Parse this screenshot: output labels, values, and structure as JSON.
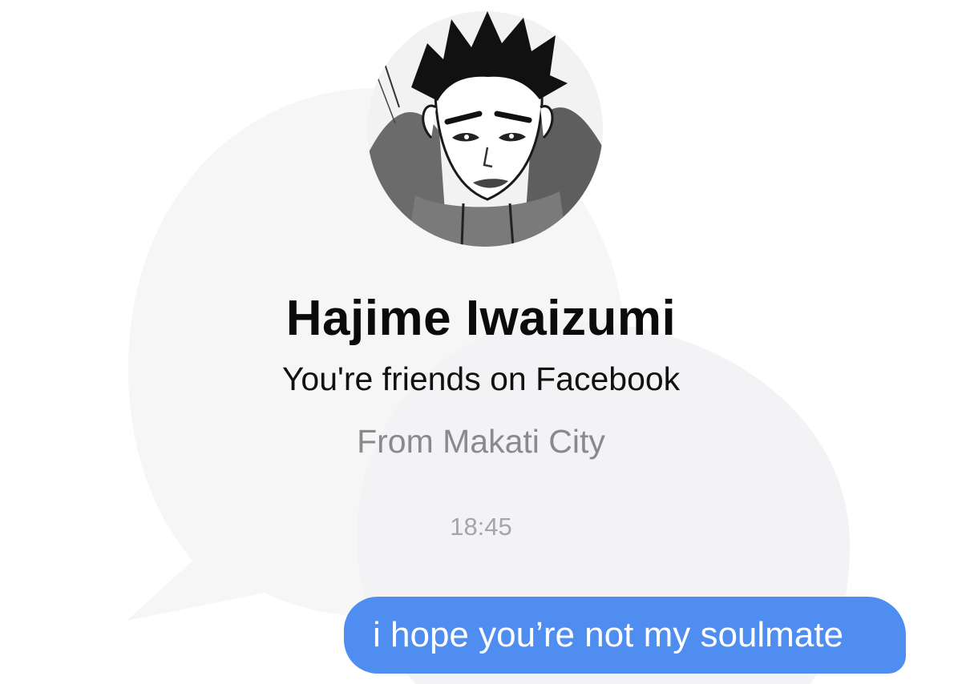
{
  "profile": {
    "avatar_icon": "anime-character-avatar-icon",
    "name": "Hajime Iwaizumi",
    "friend_status": "You're friends on Facebook",
    "location": "From Makati City"
  },
  "conversation": {
    "timestamp": "18:45",
    "messages": [
      {
        "sender": "me",
        "text": "i hope you’re not my soulmate"
      }
    ]
  },
  "colors": {
    "outgoing_bubble": "#4f8ef0",
    "name_text": "#0b0b0b",
    "secondary_text": "#8a8a8e",
    "timestamp_text": "#a5a5aa",
    "watermark": "#f6f6f7"
  }
}
